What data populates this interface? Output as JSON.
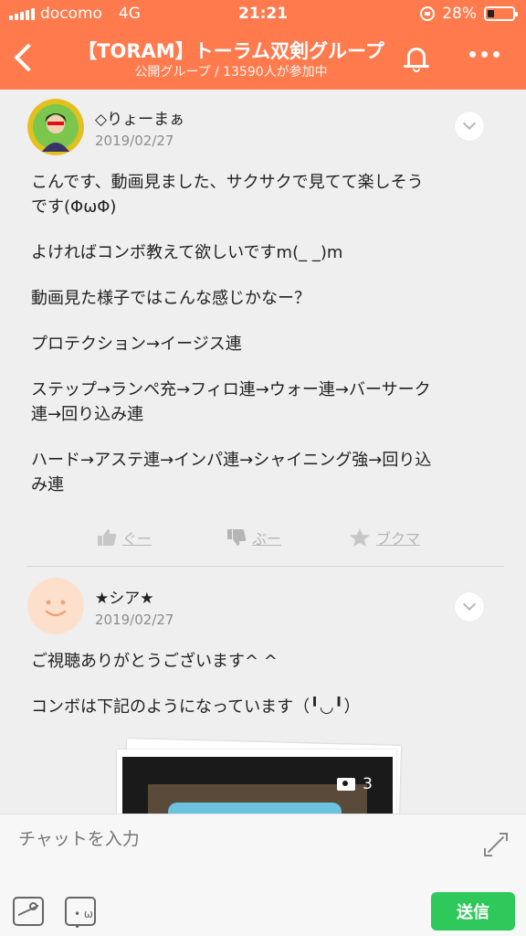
{
  "status_bar": {
    "carrier": "docomo",
    "network": "4G",
    "time": "21:21",
    "battery": "28%",
    "battery_level": 0.28
  },
  "header": {
    "title": "【TORAM】トーラム双剣グループ",
    "subtitle": "公開グループ / 13590人が参加中",
    "icons": [
      "back-icon",
      "bell-icon",
      "more-icon"
    ]
  },
  "posts": [
    {
      "author": "◇りょーまぁ",
      "date": "2019/02/27",
      "paragraphs": [
        "こんです、動画見ました、サクサクで見てて楽しそう\nです(ΦωΦ)",
        "よければコンボ教えて欲しいですm(_ _)m",
        "動画見た様子ではこんな感じかなー？",
        "プロテクション→イージス連",
        "ステップ→ランペ充→フィロ連→ウォー連→バーサーク\n連→回り込み連",
        "ハード→アステ連→インパ連→シャイニング強→回り込\nみ連"
      ],
      "reactions": {
        "good": "ぐー",
        "boo": "ぶー",
        "bookmark": "ブクマ"
      }
    },
    {
      "author": "★シア★",
      "date": "2019/02/27",
      "paragraphs": [
        "ご視聴ありがとうございます^ ^",
        "コンボは下記のようになっています（╹◡╹）"
      ],
      "attachment_count": "3"
    }
  ],
  "composer": {
    "placeholder": "チャットを入力",
    "send_label": "送信"
  },
  "colors": {
    "accent": "#ff7a4d",
    "send": "#2fc95b",
    "background": "#efefef"
  }
}
